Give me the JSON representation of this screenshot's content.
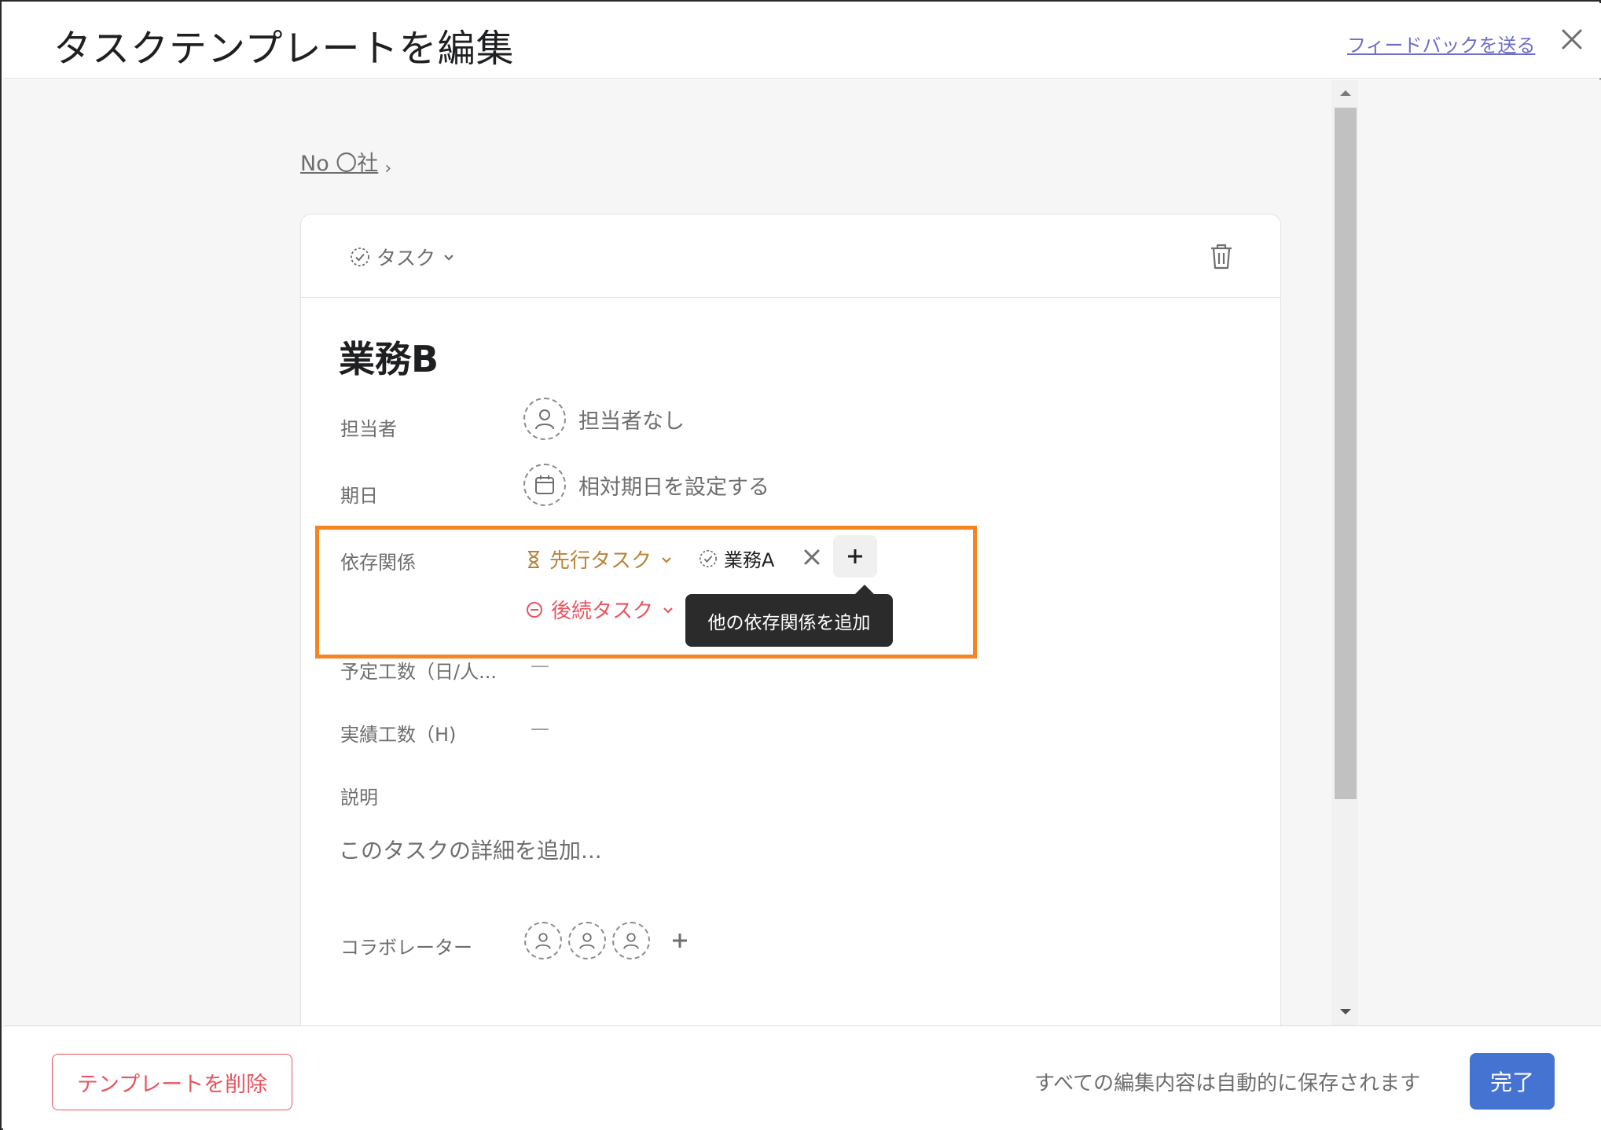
{
  "header": {
    "title": "タスクテンプレートを編集",
    "feedback_link": "フィードバックを送る",
    "close_icon": "close-icon"
  },
  "breadcrumb": {
    "project": "No 〇社"
  },
  "task": {
    "type_label": "タスク",
    "title": "業務B",
    "fields": {
      "assignee_label": "担当者",
      "assignee_value": "担当者なし",
      "due_label": "期日",
      "due_value": "相対期日を設定する",
      "dependency_label": "依存関係",
      "predecessor_label": "先行タスク",
      "predecessor_task": "業務A",
      "successor_label": "後続タスク",
      "add_dependency_tooltip": "他の依存関係を追加",
      "planned_effort_label": "予定工数（日/人...",
      "planned_effort_value": "—",
      "actual_effort_label": "実績工数（H)",
      "actual_effort_value": "—",
      "description_label": "説明",
      "description_placeholder": "このタスクの詳細を追加...",
      "collaborators_label": "コラボレーター"
    }
  },
  "footer": {
    "delete_button": "テンプレートを削除",
    "autosave_text": "すべての編集内容は自動的に保存されます",
    "done_button": "完了"
  },
  "colors": {
    "accent_blue": "#4573d2",
    "danger_red": "#e8545f",
    "predecessor_gold": "#b88438",
    "highlight_orange": "#f58421",
    "link_purple": "#6d6ec9"
  }
}
